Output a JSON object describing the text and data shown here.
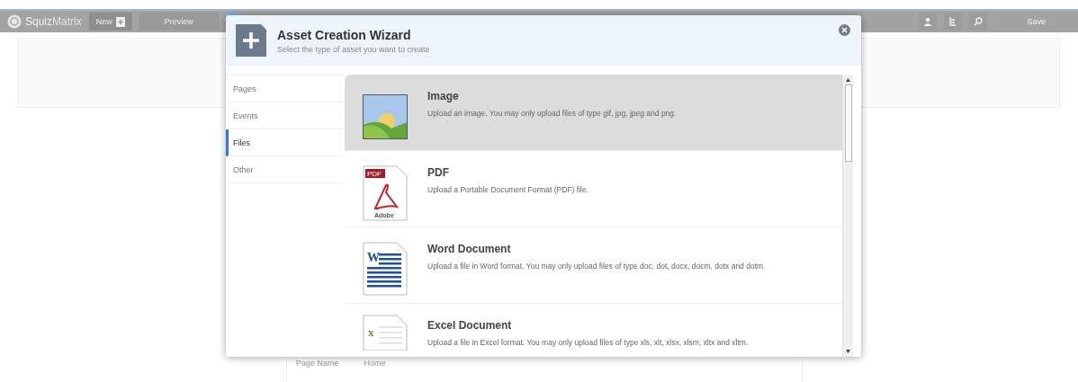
{
  "toolbar": {
    "brand": "**Squiz**Matrix",
    "buttons": [
      {
        "label": "New",
        "kind": "new"
      },
      {
        "label": "Preview",
        "kind": "plain"
      }
    ],
    "active_tab": {
      "selected": true
    },
    "save": {
      "label": "Save",
      "disabled": true
    }
  },
  "page": {
    "field": {
      "label": "Page Name",
      "value": "Home"
    }
  },
  "wizard": {
    "title": "Asset Creation Wizard",
    "subtitle": "Select the type of asset you want to create",
    "categories": [
      {
        "label": "Pages",
        "selected": false
      },
      {
        "label": "Events",
        "selected": false
      },
      {
        "label": "Files",
        "selected": true
      },
      {
        "label": "Other",
        "selected": false
      }
    ],
    "assets": [
      {
        "kind": "image",
        "name": "Image",
        "description": "Upload an image. You may only upload files of type gif, jpg, jpeg and png.",
        "selected": true
      },
      {
        "kind": "pdf",
        "name": "PDF",
        "description": "Upload a Portable Document Format (PDF) file.",
        "icon_text": [
          "PDF",
          "Adobe"
        ],
        "selected": false
      },
      {
        "kind": "word",
        "name": "Word Document",
        "description": "Upload a file in Word format. You may only upload files of type doc, dot, docx, docm, dotx and dotm.",
        "icon_text": [
          "W"
        ],
        "selected": false
      },
      {
        "kind": "excel",
        "name": "Excel Document",
        "description": "Upload a file in Excel format. You may only upload files of type xls, xlt, xlsx, xlsm, xltx and xltm.",
        "icon_text": [
          "x"
        ],
        "selected": false
      }
    ]
  }
}
